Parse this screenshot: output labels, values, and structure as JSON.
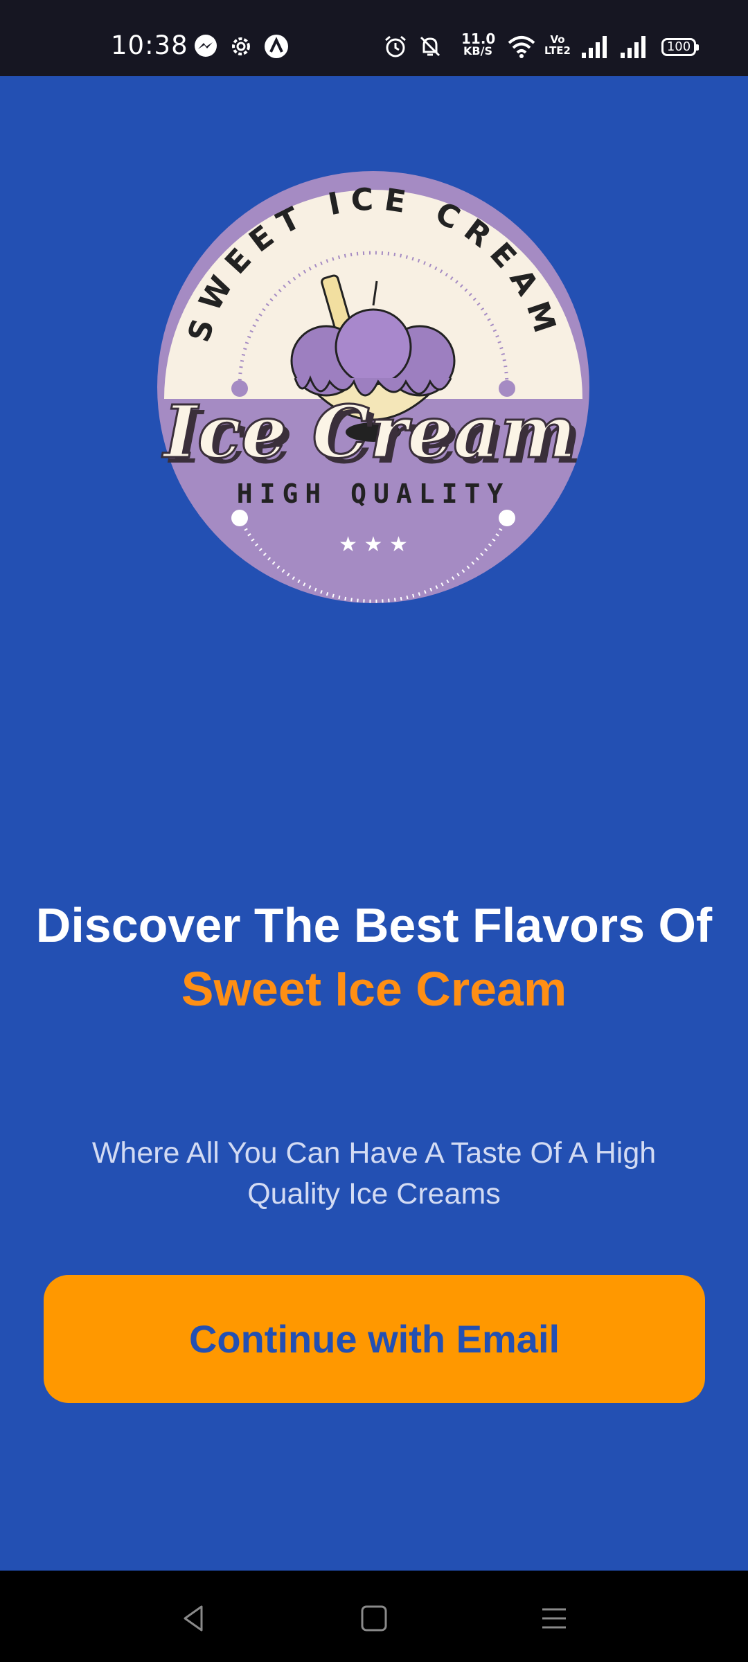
{
  "status_bar": {
    "time": "10:38",
    "net_speed_value": "11.0",
    "net_speed_unit": "KB/S",
    "volte_top": "Vo",
    "volte_bottom": "LTE2",
    "battery": "100",
    "icons": [
      "messenger-icon",
      "settings-gear-icon",
      "app-a-icon",
      "alarm-icon",
      "mute-icon",
      "wifi-icon",
      "signal-icon",
      "signal-icon"
    ]
  },
  "logo": {
    "arc_text": "SWEET ICE CREAM",
    "main_text": "Ice Cream",
    "sub_text": "HIGH QUALITY",
    "stars": "★ ★ ★"
  },
  "headline": {
    "line1": "Discover The Best Flavors Of",
    "line2": "Sweet Ice Cream"
  },
  "subtitle": "Where All You Can Have A Taste Of A High Quality Ice Creams",
  "cta": {
    "label": "Continue with Email"
  },
  "colors": {
    "background": "#2350b3",
    "accent": "#ff8f14",
    "button": "#ff9800",
    "button_text": "#2350b3",
    "logo_purple": "#a58bc3",
    "logo_cream": "#f8f0e3"
  },
  "nav_bar": {
    "buttons": [
      "back-icon",
      "home-icon",
      "recents-icon"
    ]
  }
}
